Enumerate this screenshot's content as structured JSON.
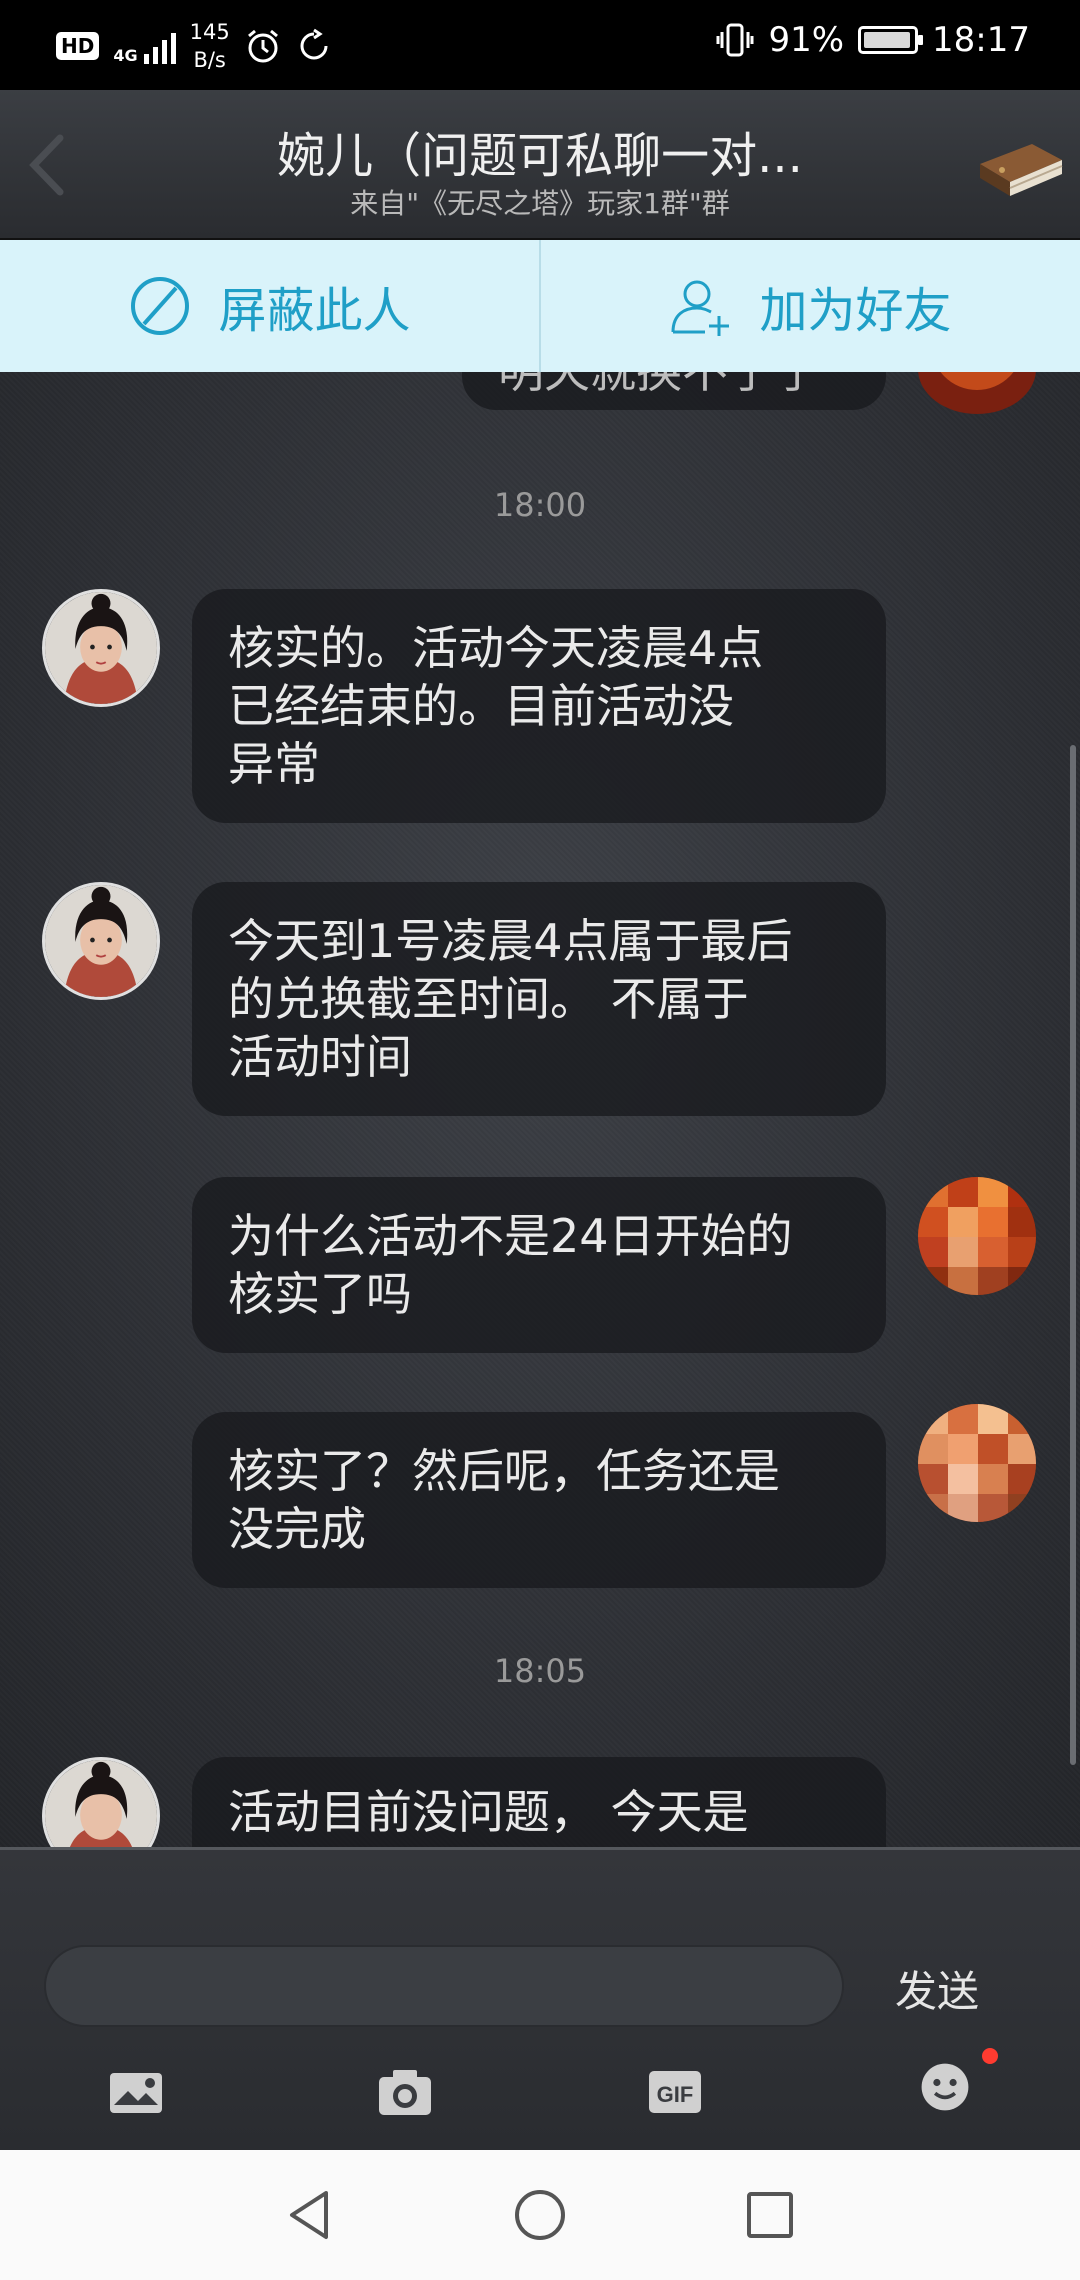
{
  "status_bar": {
    "hd": "HD",
    "network": "4G",
    "speed_value": "145",
    "speed_unit": "B/s",
    "battery": "91%",
    "time": "18:17",
    "icons": [
      "alarm-icon",
      "sync-icon",
      "vibrate-icon",
      "battery-icon"
    ]
  },
  "header": {
    "title": "婉儿（问题可私聊一对...",
    "subtitle": "来自\"《无尽之塔》玩家1群\"群"
  },
  "actions": {
    "block": "屏蔽此人",
    "add_friend": "加为好友"
  },
  "chat": {
    "partial_top": "明天就换不了了",
    "time_1": "18:00",
    "time_2": "18:05",
    "messages": [
      {
        "side": "left",
        "text_lines": [
          "核实的。活动今天凌晨4点",
          "已经结束的。目前活动没",
          "异常"
        ]
      },
      {
        "side": "left",
        "text_lines": [
          "今天到1号凌晨4点属于最后",
          "的兑换截至时间。 不属于",
          "活动时间"
        ]
      },
      {
        "side": "right",
        "text_lines": [
          "为什么活动不是24日开始的",
          "核实了吗"
        ]
      },
      {
        "side": "right",
        "text_lines": [
          "核实了？然后呢，任务还是",
          "没完成"
        ]
      },
      {
        "side": "left",
        "text_lines": [
          "活动目前没问题， 今天是"
        ]
      }
    ]
  },
  "input": {
    "placeholder": "",
    "send_label": "发送"
  },
  "toolbar": {
    "icons": [
      "image-icon",
      "camera-icon",
      "gif-icon",
      "emoji-icon"
    ],
    "gif_label": "GIF"
  },
  "colors": {
    "accent": "#1f9fc7",
    "action_bg": "#d9f3fa",
    "badge_red": "#ff3b30"
  }
}
